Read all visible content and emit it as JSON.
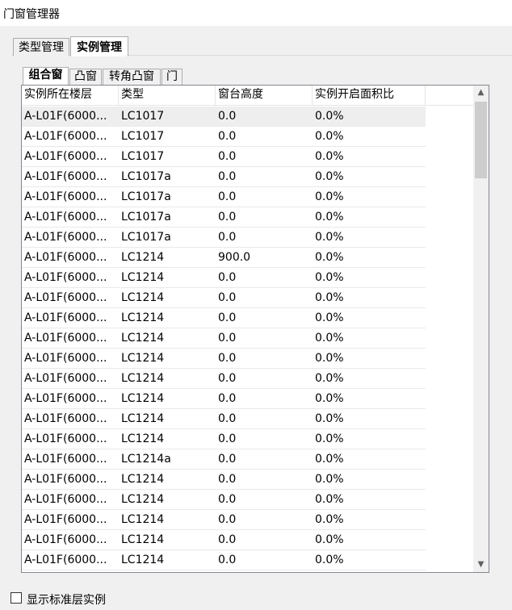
{
  "window": {
    "title": "门窗管理器"
  },
  "tabs": {
    "type_label": "类型管理",
    "instance_label": "实例管理"
  },
  "subtabs": {
    "combo": "组合窗",
    "bay": "凸窗",
    "corner_bay": "转角凸窗",
    "door": "门"
  },
  "table": {
    "headers": [
      "实例所在楼层",
      "类型",
      "窗台高度",
      "实例开启面积比"
    ],
    "rows": [
      [
        "A-L01F(6000...",
        "LC1017",
        "0.0",
        "0.0%"
      ],
      [
        "A-L01F(6000...",
        "LC1017",
        "0.0",
        "0.0%"
      ],
      [
        "A-L01F(6000...",
        "LC1017",
        "0.0",
        "0.0%"
      ],
      [
        "A-L01F(6000...",
        "LC1017a",
        "0.0",
        "0.0%"
      ],
      [
        "A-L01F(6000...",
        "LC1017a",
        "0.0",
        "0.0%"
      ],
      [
        "A-L01F(6000...",
        "LC1017a",
        "0.0",
        "0.0%"
      ],
      [
        "A-L01F(6000...",
        "LC1017a",
        "0.0",
        "0.0%"
      ],
      [
        "A-L01F(6000...",
        "LC1214",
        "900.0",
        "0.0%"
      ],
      [
        "A-L01F(6000...",
        "LC1214",
        "0.0",
        "0.0%"
      ],
      [
        "A-L01F(6000...",
        "LC1214",
        "0.0",
        "0.0%"
      ],
      [
        "A-L01F(6000...",
        "LC1214",
        "0.0",
        "0.0%"
      ],
      [
        "A-L01F(6000...",
        "LC1214",
        "0.0",
        "0.0%"
      ],
      [
        "A-L01F(6000...",
        "LC1214",
        "0.0",
        "0.0%"
      ],
      [
        "A-L01F(6000...",
        "LC1214",
        "0.0",
        "0.0%"
      ],
      [
        "A-L01F(6000...",
        "LC1214",
        "0.0",
        "0.0%"
      ],
      [
        "A-L01F(6000...",
        "LC1214",
        "0.0",
        "0.0%"
      ],
      [
        "A-L01F(6000...",
        "LC1214",
        "0.0",
        "0.0%"
      ],
      [
        "A-L01F(6000...",
        "LC1214a",
        "0.0",
        "0.0%"
      ],
      [
        "A-L01F(6000...",
        "LC1214",
        "0.0",
        "0.0%"
      ],
      [
        "A-L01F(6000...",
        "LC1214",
        "0.0",
        "0.0%"
      ],
      [
        "A-L01F(6000...",
        "LC1214",
        "0.0",
        "0.0%"
      ],
      [
        "A-L01F(6000...",
        "LC1214",
        "0.0",
        "0.0%"
      ],
      [
        "A-L01F(6000...",
        "LC1214",
        "0.0",
        "0.0%"
      ]
    ]
  },
  "scroll_icons": {
    "up": "chevron-up-icon",
    "down": "chevron-down-icon"
  },
  "footer": {
    "checkbox_label": "显示标准层实例",
    "checked": false
  }
}
